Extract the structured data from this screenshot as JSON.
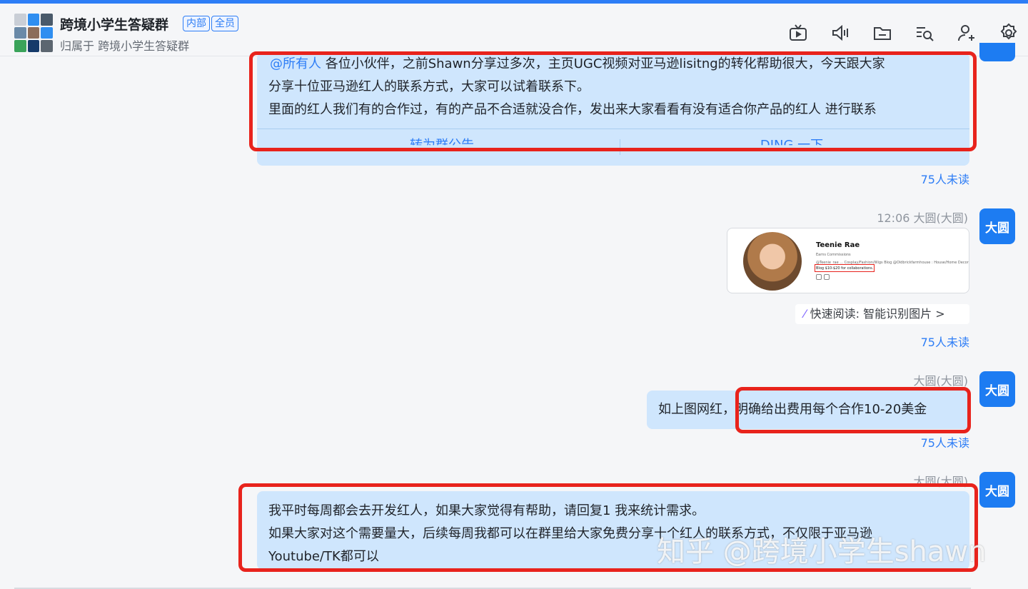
{
  "header": {
    "title": "跨境小学生答疑群",
    "tags": [
      "内部",
      "全员"
    ],
    "subtitle": "归属于 跨境小学生答疑群",
    "toolbar_icons": [
      "live-video-icon",
      "voice-call-icon",
      "folder-icon",
      "search-messages-icon",
      "add-member-icon",
      "settings-icon"
    ]
  },
  "messages": {
    "msg1": {
      "mention": "@所有人",
      "line1": " 各位小伙伴，之前Shawn分享过多次，主页UGC视频对亚马逊lisitng的转化帮助很大，今天跟大家",
      "line2": "分享十位亚马逊红人的联系方式，大家可以试着联系下。",
      "line3": "里面的红人我们有的合作过，有的产品不合适就没合作，发出来大家看看有没有适合你产品的红人 进行联系",
      "action_left": "转为群公告",
      "action_right": "DING 一下",
      "read_status": "75人未读"
    },
    "msg2": {
      "time_sender": "12:06  大圆(大圆)",
      "avatar_label": "大圆",
      "card": {
        "name": "Teenie Rae",
        "subtitle": "Earns Commissions",
        "bio": "@Teenie_rae ... Cosplay/Fashion/Wigs Blog @Oldbrickfarmhouse : House/Home Decor",
        "highlight": "Blog $10-$20 for collaborations."
      },
      "smart_read": "快速阅读: 智能识别图片 >",
      "read_status": "75人未读"
    },
    "msg3": {
      "sender": "大圆(大圆)",
      "avatar_label": "大圆",
      "text_prefix": "如上图网红，",
      "text_highlight": "明确给出费用每个合作10-20美金",
      "read_status": "75人未读"
    },
    "msg4": {
      "sender": "大圆(大圆)",
      "avatar_label": "大圆",
      "line1": "我平时每周都会去开发红人，如果大家觉得有帮助，请回复1 我来统计需求。",
      "line2": "如果大家对这个需要量大，后续每周我都可以在群里给大家免费分享十个红人的联系方式，不仅限于亚马逊",
      "line3": "Youtube/TK都可以"
    }
  },
  "watermark": "知乎 @跨境小学生shawn",
  "colors": {
    "accent": "#2d7df6",
    "bubble": "#cfe6fd",
    "annotation_red": "#e8231c",
    "avatar": "#1d7cf2"
  }
}
